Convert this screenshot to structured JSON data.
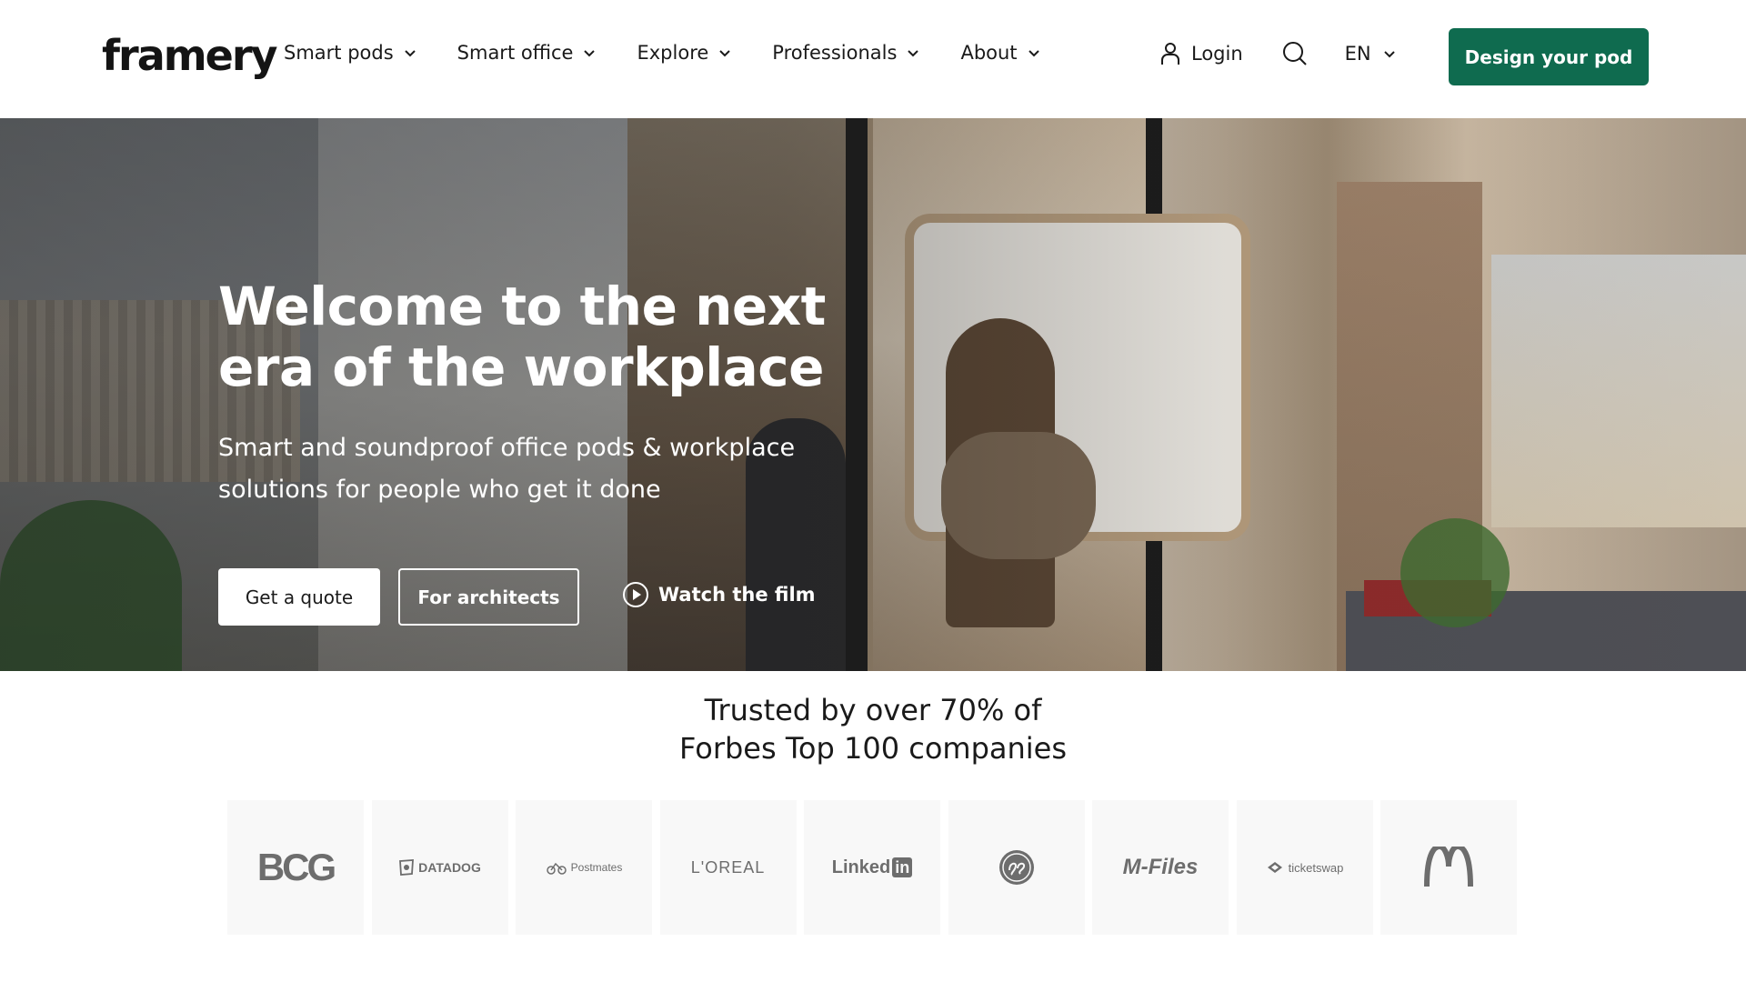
{
  "header": {
    "logo": "framery",
    "nav": [
      {
        "label": "Smart pods"
      },
      {
        "label": "Smart office"
      },
      {
        "label": "Explore"
      },
      {
        "label": "Professionals"
      },
      {
        "label": "About"
      }
    ],
    "login_label": "Login",
    "lang_label": "EN",
    "cta_label": "Design your pod"
  },
  "hero": {
    "title": "Welcome to the next era of the workplace",
    "subtitle": "Smart and soundproof office pods & workplace solutions for people who get it done",
    "quote_label": "Get a quote",
    "architects_label": "For architects",
    "film_label": "Watch the film"
  },
  "trusted": {
    "line1": "Trusted by over 70% of",
    "line2": "Forbes Top 100 companies",
    "logos": [
      "BCG",
      "DATADOG",
      "Postmates",
      "L'OREAL",
      "Linked",
      "in",
      "M-Files",
      "ticketswap"
    ]
  },
  "colors": {
    "brand_green": "#0f6b4f",
    "logo_tile_bg": "#f8f8f8",
    "logo_grey": "#6d6d6d"
  }
}
